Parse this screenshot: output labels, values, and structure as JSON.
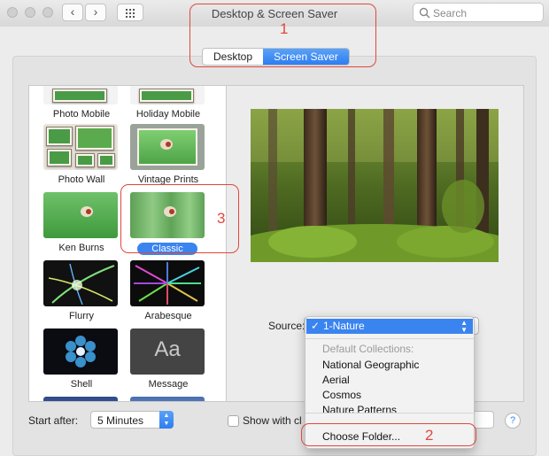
{
  "window": {
    "title": "Desktop & Screen Saver"
  },
  "toolbar": {
    "back_icon": "chevron-left-icon",
    "forward_icon": "chevron-right-icon",
    "grid_icon": "grid-icon",
    "search_placeholder": "Search"
  },
  "tabs": [
    {
      "label": "Desktop",
      "selected": false
    },
    {
      "label": "Screen Saver",
      "selected": true
    }
  ],
  "savers": [
    {
      "label": "Photo Mobile"
    },
    {
      "label": "Holiday Mobile"
    },
    {
      "label": "Photo Wall"
    },
    {
      "label": "Vintage Prints"
    },
    {
      "label": "Ken Burns"
    },
    {
      "label": "Classic",
      "selected": true
    },
    {
      "label": "Flurry"
    },
    {
      "label": "Arabesque"
    },
    {
      "label": "Shell"
    },
    {
      "label": "Message",
      "thumb_text": "Aa"
    }
  ],
  "source": {
    "label": "Source",
    "menu": {
      "selected": "1-Nature",
      "section_header": "Default Collections:",
      "items": [
        "National Geographic",
        "Aerial",
        "Cosmos",
        "Nature Patterns"
      ],
      "choose_folder": "Choose Folder..."
    }
  },
  "bottom": {
    "start_after_label": "Start after:",
    "start_after_value": "5 Minutes",
    "show_with_clock_label": "Show with cl",
    "help_label": "?"
  },
  "annotations": [
    "1",
    "2",
    "3"
  ],
  "colors": {
    "accent": "#3a84f0",
    "annotation": "#e0483c"
  }
}
